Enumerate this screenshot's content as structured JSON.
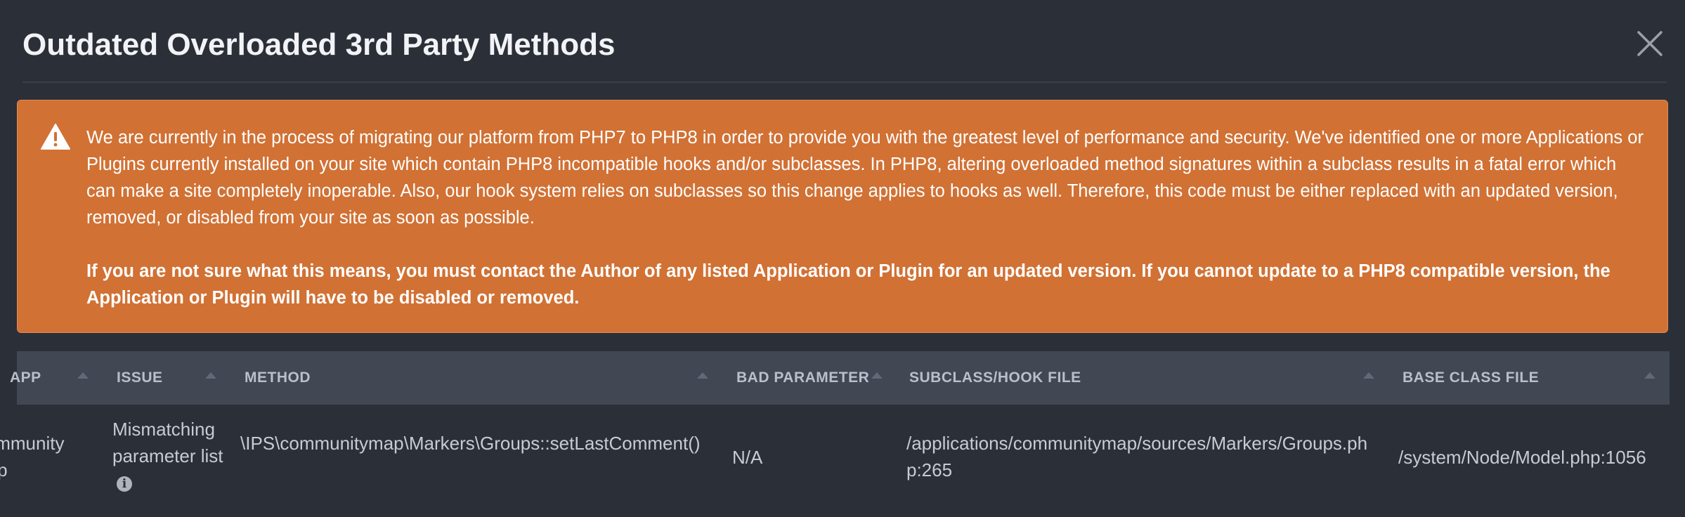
{
  "dialog": {
    "title": "Outdated Overloaded 3rd Party Methods",
    "close_icon": "close-icon"
  },
  "alert": {
    "icon": "warning-icon",
    "color": "#d17134",
    "message": "We are currently in the process of migrating our platform from PHP7 to PHP8 in order to provide you with the greatest level of performance and security. We've identified one or more Applications or Plugins currently installed on your site which contain PHP8 incompatible hooks and/or subclasses. In PHP8, altering overloaded method signatures within a subclass results in a fatal error which can make a site completely inoperable. Also, our hook system relies on subclasses so this change applies to hooks as well. Therefore, this code must be either replaced with an updated version, removed, or disabled from your site as soon as possible.",
    "strong_message": "If you are not sure what this means, you must contact the Author of any listed Application or Plugin for an updated version. If you cannot update to a PHP8 compatible version, the Application or Plugin will have to be disabled or removed."
  },
  "table": {
    "columns": [
      "APP",
      "ISSUE",
      "METHOD",
      "BAD PARAMETER",
      "SUBCLASS/HOOK FILE",
      "BASE CLASS FILE"
    ],
    "rows": [
      {
        "app": "Community Map",
        "issue": "Mismatching parameter list",
        "issue_icon": "info-icon",
        "method": "\\IPS\\communitymap\\Markers\\Groups::setLastComment()",
        "bad_parameter": "N/A",
        "subclass_file": "/applications/communitymap/sources/Markers/Groups.php:265",
        "base_class_file": "/system/Node/Model.php:1056"
      }
    ]
  }
}
